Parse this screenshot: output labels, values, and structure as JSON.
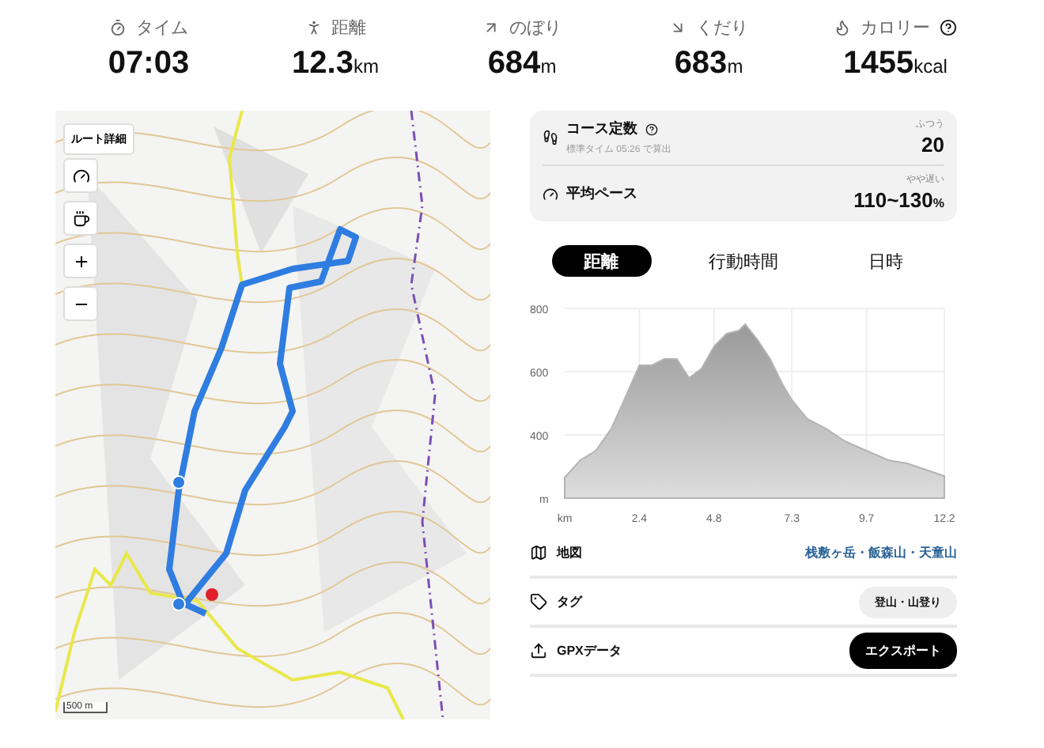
{
  "stats": [
    {
      "kind": "time",
      "label": "タイム",
      "value": "07:03"
    },
    {
      "kind": "distance",
      "label": "距離",
      "value": "12.3",
      "unit": "km"
    },
    {
      "kind": "up",
      "label": "のぼり",
      "value": "684",
      "unit": "m"
    },
    {
      "kind": "down",
      "label": "くだり",
      "value": "683",
      "unit": "m"
    },
    {
      "kind": "calorie",
      "label": "カロリー",
      "value": "1455",
      "unit": "kcal",
      "help": true
    }
  ],
  "map": {
    "route_button": "ルート詳細",
    "scale": "500 m"
  },
  "summary": [
    {
      "kind": "course",
      "label": "コース定数",
      "note": "標準タイム 05:26 で算出",
      "tag": "ふつう",
      "value": "20",
      "help": true
    },
    {
      "kind": "pace",
      "label": "平均ペース",
      "tag": "やや遅い",
      "value": "110~130",
      "unit": "%"
    }
  ],
  "tabs": [
    {
      "label": "距離",
      "selected": true
    },
    {
      "label": "行動時間",
      "selected": false
    },
    {
      "label": "日時",
      "selected": false
    }
  ],
  "chart_data": {
    "type": "area",
    "x": [
      0,
      0.5,
      1,
      1.5,
      2,
      2.4,
      2.8,
      3.2,
      3.6,
      4,
      4.4,
      4.8,
      5.2,
      5.6,
      5.8,
      6.2,
      6.6,
      7,
      7.3,
      7.8,
      8.4,
      9,
      9.7,
      10.4,
      11,
      11.6,
      12.2
    ],
    "grid": true,
    "series": [
      {
        "color": "#b4b4b4",
        "values": [
          265,
          320,
          350,
          420,
          530,
          620,
          620,
          640,
          640,
          580,
          610,
          680,
          720,
          730,
          750,
          700,
          640,
          560,
          510,
          450,
          420,
          380,
          350,
          320,
          310,
          290,
          270
        ]
      }
    ],
    "ylabel": "m",
    "xlabel": "km",
    "ylim": [
      200,
      800
    ],
    "xlim": [
      0,
      12.2
    ],
    "yticks": [
      400,
      600,
      800
    ],
    "xticks": [
      2.4,
      4.8,
      7.3,
      9.7,
      12.2
    ]
  },
  "rows": [
    {
      "kind": "map",
      "label": "地図",
      "value": "栈敷ヶ岳・飯森山・天童山"
    },
    {
      "kind": "tag",
      "label": "タグ",
      "value": "登山・山登り"
    },
    {
      "kind": "gpx",
      "label": "GPXデータ",
      "value": "エクスポート"
    }
  ]
}
